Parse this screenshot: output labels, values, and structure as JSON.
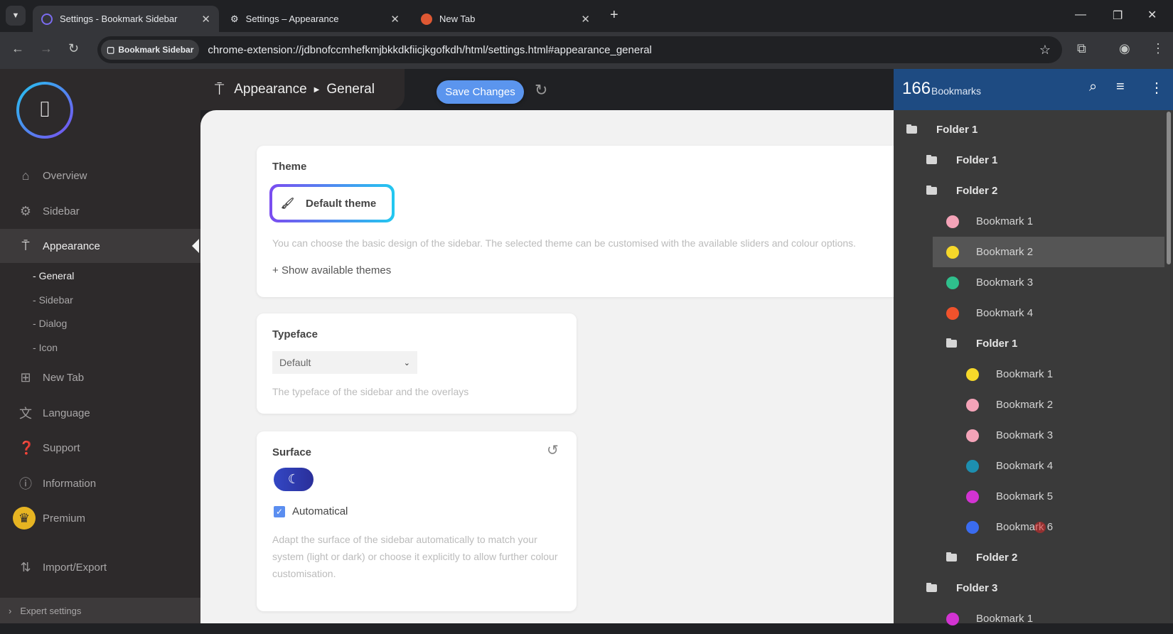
{
  "browser": {
    "tabs": [
      {
        "title": "Settings - Bookmark Sidebar",
        "icon": "bookmark-sidebar-icon"
      },
      {
        "title": "Settings – Appearance",
        "icon": "gear-icon"
      },
      {
        "title": "New Tab",
        "icon": "duckduckgo-icon"
      }
    ],
    "site_chip": "Bookmark Sidebar",
    "url": "chrome-extension://jdbnofccmhefkmjbkkdkfiicjkgofkdh/html/settings.html#appearance_general"
  },
  "nav": {
    "items": [
      {
        "label": "Overview",
        "icon": "home-icon"
      },
      {
        "label": "Sidebar",
        "icon": "gear-icon"
      },
      {
        "label": "Appearance",
        "icon": "paint-roller-icon"
      }
    ],
    "subitems": [
      "General",
      "Sidebar",
      "Dialog",
      "Icon"
    ],
    "items2": [
      {
        "label": "New Tab",
        "icon": "new-tab-icon"
      },
      {
        "label": "Language",
        "icon": "translate-icon"
      },
      {
        "label": "Support",
        "icon": "help-icon"
      },
      {
        "label": "Information",
        "icon": "info-icon"
      },
      {
        "label": "Premium",
        "icon": "crown-icon"
      },
      {
        "label": "Import/Export",
        "icon": "import-export-icon"
      }
    ],
    "expert": "Expert settings"
  },
  "header": {
    "crumb1": "Appearance",
    "crumb2": "General",
    "save": "Save Changes"
  },
  "theme": {
    "title": "Theme",
    "selected": "Default theme",
    "desc": "You can choose the basic design of the sidebar. The selected theme can be customised with the available sliders and colour options.",
    "show": "Show available themes"
  },
  "typeface": {
    "title": "Typeface",
    "value": "Default",
    "desc": "The typeface of the sidebar and the overlays"
  },
  "surface": {
    "title": "Surface",
    "auto_label": "Automatical",
    "auto_checked": true,
    "desc": "Adapt the surface of the sidebar automatically to match your system (light or dark) or choose it explicitly to allow further colour customisation."
  },
  "panel": {
    "count": "166",
    "label": "Bookmarks",
    "rows": [
      {
        "t": "folder",
        "label": "Folder 1",
        "level": 0
      },
      {
        "t": "folder",
        "label": "Folder 1",
        "level": 1
      },
      {
        "t": "folder",
        "label": "Folder 2",
        "level": 1
      },
      {
        "t": "bm",
        "label": "Bookmark 1",
        "level": 2,
        "color": "#f4a3b8"
      },
      {
        "t": "bm",
        "label": "Bookmark 2",
        "level": 2,
        "color": "#f6d82a",
        "hover": true
      },
      {
        "t": "bm",
        "label": "Bookmark 3",
        "level": 2,
        "color": "#2fbf8c"
      },
      {
        "t": "bm",
        "label": "Bookmark 4",
        "level": 2,
        "color": "#f0522c"
      },
      {
        "t": "folder",
        "label": "Folder 1",
        "level": 2
      },
      {
        "t": "bm",
        "label": "Bookmark 1",
        "level": 3,
        "color": "#f6d82a"
      },
      {
        "t": "bm",
        "label": "Bookmark 2",
        "level": 3,
        "color": "#f4a3b8"
      },
      {
        "t": "bm",
        "label": "Bookmark 3",
        "level": 3,
        "color": "#f4a3b8"
      },
      {
        "t": "bm",
        "label": "Bookmark 4",
        "level": 3,
        "color": "#1d8fb0"
      },
      {
        "t": "bm",
        "label": "Bookmark 5",
        "level": 3,
        "color": "#d233d2"
      },
      {
        "t": "bm",
        "label": "Bookmark 6",
        "level": 3,
        "color": "#3a6cf0"
      },
      {
        "t": "folder",
        "label": "Folder 2",
        "level": 2
      },
      {
        "t": "folder",
        "label": "Folder 3",
        "level": 1
      },
      {
        "t": "bm",
        "label": "Bookmark 1",
        "level": 2,
        "color": "#d233d2"
      }
    ]
  }
}
